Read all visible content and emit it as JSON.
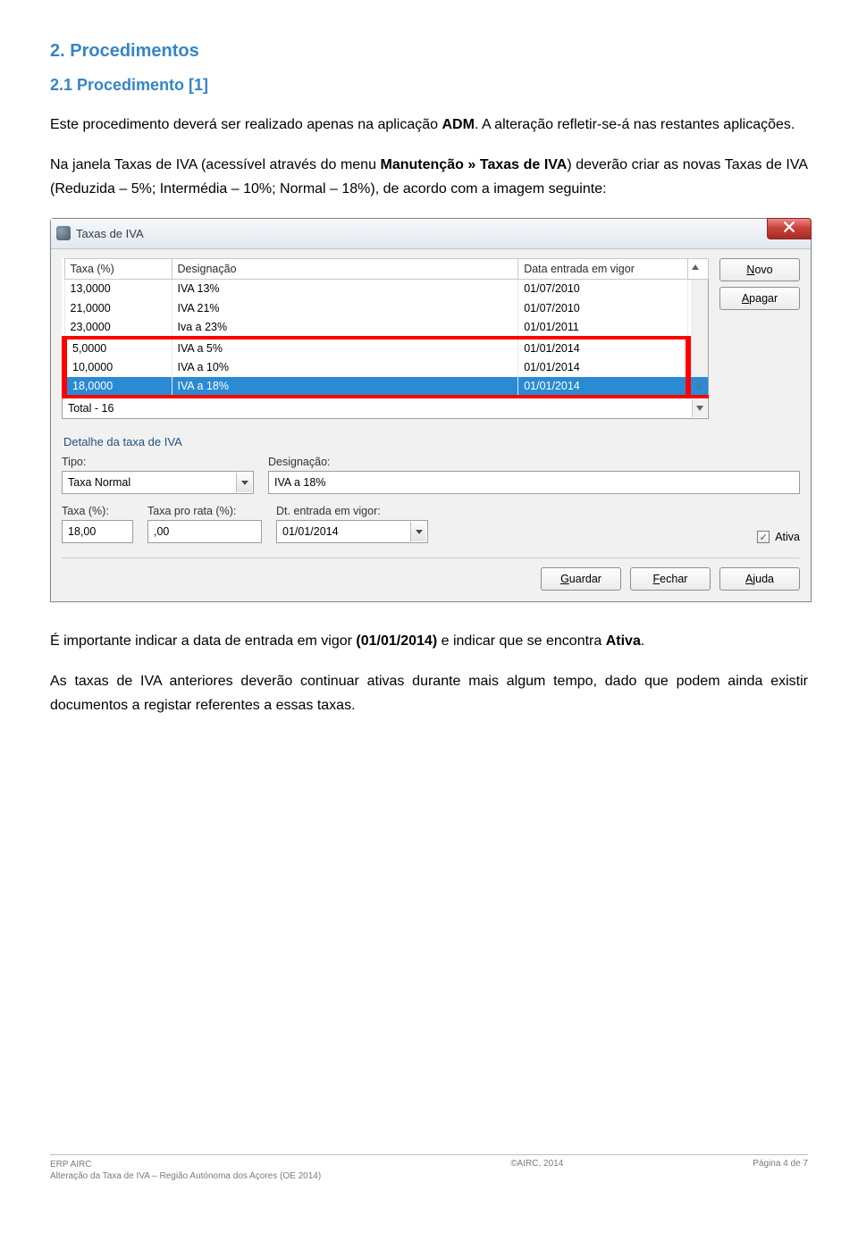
{
  "doc": {
    "h1": "2. Procedimentos",
    "h2": "2.1 Procedimento [1]",
    "p1_a": "Este procedimento deverá ser realizado apenas na aplicação ",
    "p1_b": "ADM",
    "p1_c": ". A alteração refletir-se-á nas restantes aplicações.",
    "p2_a": "Na janela Taxas de IVA (acessível através do menu ",
    "p2_b": "Manutenção » Taxas de IVA",
    "p2_c": ") deverão criar as novas Taxas de IVA (Reduzida – 5%; Intermédia – 10%; Normal – 18%), de acordo com a imagem seguinte:",
    "p3_a": "É importante indicar a data de entrada em vigor ",
    "p3_b": "(01/01/2014)",
    "p3_c": " e indicar que se encontra ",
    "p3_d": "Ativa",
    "p3_e": ".",
    "p4": "As taxas de IVA anteriores deverão continuar ativas durante mais algum tempo, dado que podem ainda existir documentos a registar referentes a essas taxas."
  },
  "window": {
    "title": "Taxas de IVA",
    "buttons": {
      "novo": "Novo",
      "apagar": "Apagar",
      "guardar": "Guardar",
      "fechar": "Fechar",
      "ajuda": "Ajuda"
    },
    "columns": {
      "taxa": "Taxa (%)",
      "desig": "Designação",
      "data": "Data entrada em vigor"
    },
    "rows": [
      {
        "taxa": "13,0000",
        "desig": "IVA 13%",
        "data": "01/07/2010"
      },
      {
        "taxa": "21,0000",
        "desig": "IVA 21%",
        "data": "01/07/2010"
      },
      {
        "taxa": "23,0000",
        "desig": "Iva a 23%",
        "data": "01/01/2011"
      },
      {
        "taxa": "5,0000",
        "desig": "IVA a 5%",
        "data": "01/01/2014"
      },
      {
        "taxa": "10,0000",
        "desig": "IVA a 10%",
        "data": "01/01/2014"
      },
      {
        "taxa": "18,0000",
        "desig": "IVA a 18%",
        "data": "01/01/2014"
      }
    ],
    "total": "Total - 16",
    "scrollbar_mark": "≡",
    "detail": {
      "title": "Detalhe da taxa de IVA",
      "tipo_label": "Tipo:",
      "tipo": "Taxa Normal",
      "desig_label": "Designação:",
      "desig": "IVA a 18%",
      "taxa_label": "Taxa (%):",
      "taxa": "18,00",
      "prorata_label": "Taxa pro rata (%):",
      "prorata": ",00",
      "dt_label": "Dt. entrada em vigor:",
      "dt": "01/01/2014",
      "ativa_label": "Ativa",
      "ativa_check": "✓"
    }
  },
  "footer": {
    "left1": "ERP AIRC",
    "left2": "Alteração da Taxa de IVA – Região Autónoma dos Açores (OE 2014)",
    "center": "©AIRC, 2014",
    "right": "Página 4 de 7"
  }
}
